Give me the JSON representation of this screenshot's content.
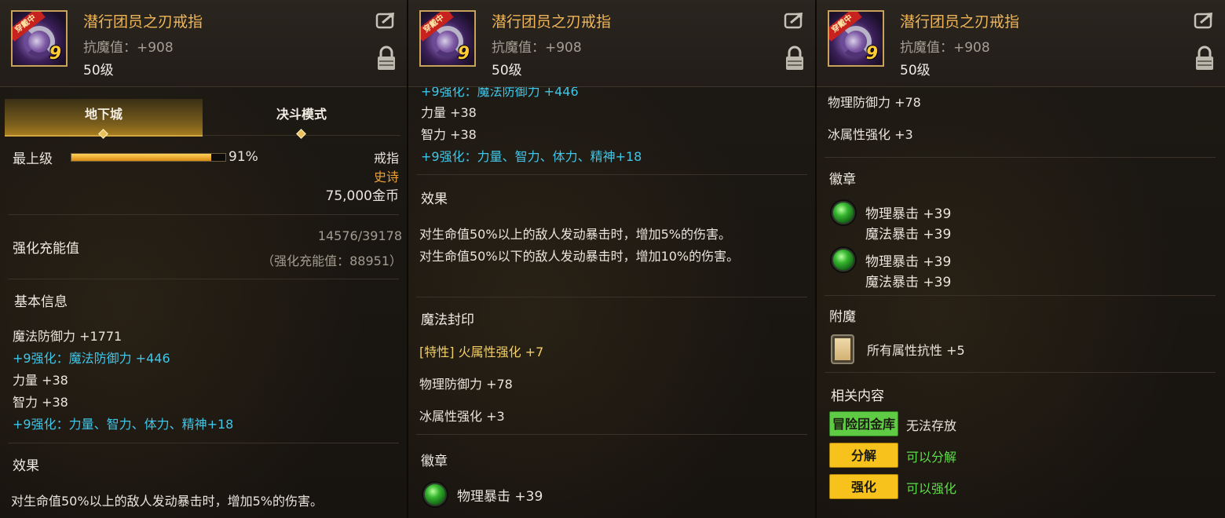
{
  "colors": {
    "item_name": "#f0b658",
    "enhance_text": "#3fc6e8",
    "rarity_epic": "#e9a23b",
    "status_green": "#5fdc4a",
    "tab_active": "#a67c1f"
  },
  "item": {
    "name": "潜行团员之刃戒指",
    "stat": "抗魔值：+908",
    "level": "50级",
    "badge": "穿戴中",
    "enhance_level": "9",
    "icon": "ring-icon"
  },
  "tabs": [
    "地下城",
    "决斗模式"
  ],
  "summary": {
    "grade_label": "最上级",
    "grade_percent": 91,
    "grade_percent_text": "91%",
    "type": "戒指",
    "rarity": "史诗",
    "price": "75,000金币"
  },
  "charge": {
    "label": "强化充能值",
    "value": "14576/39178",
    "detail": "（强化充能值：88951）"
  },
  "basic_info": {
    "title": "基本信息",
    "lines": [
      "魔法防御力 +1771",
      "+9强化：魔法防御力 +446",
      "力量 +38",
      "智力 +38",
      "+9强化：力量、智力、体力、精神+18"
    ]
  },
  "effect": {
    "title": "效果",
    "lines": [
      "对生命值50%以上的敌人发动暴击时，增加5%的伤害。",
      "对生命值50%以下的敌人发动暴击时，增加10%的伤害。"
    ]
  },
  "seal": {
    "title": "魔法封印",
    "lines": [
      "[特性] 火属性强化 +7",
      "物理防御力 +78",
      "冰属性强化 +3"
    ]
  },
  "emblem": {
    "title": "徽章",
    "slots": [
      {
        "line1": "物理暴击 +39",
        "line2": "魔法暴击 +39"
      },
      {
        "line1": "物理暴击 +39",
        "line2": "魔法暴击 +39"
      }
    ]
  },
  "enchant": {
    "title": "附魔",
    "line": "所有属性抗性 +5"
  },
  "related": {
    "title": "相关内容",
    "rows": [
      {
        "tag": "冒险团金库",
        "status": "无法存放"
      },
      {
        "tag": "分解",
        "status": "可以分解"
      },
      {
        "tag": "强化",
        "status": "可以强化"
      }
    ]
  }
}
